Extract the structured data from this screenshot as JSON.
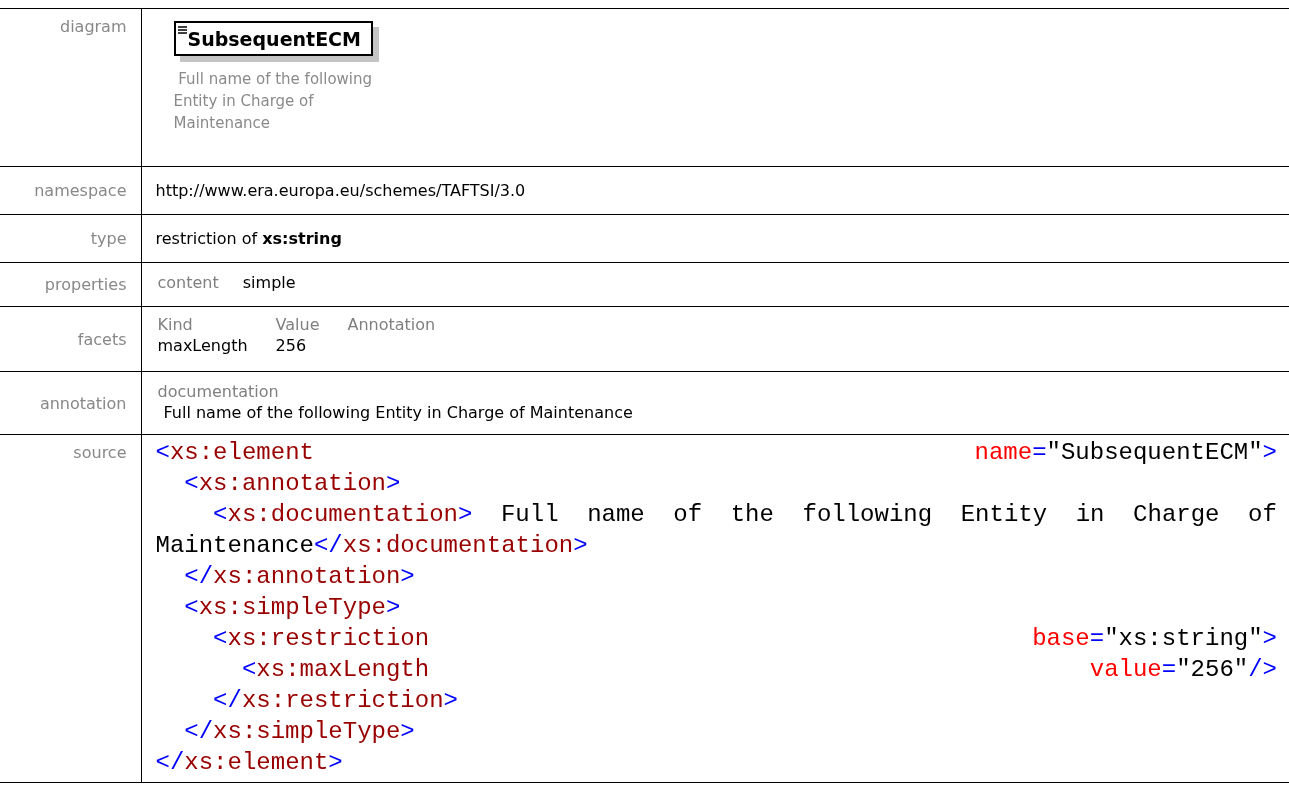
{
  "rows": [
    {
      "label": "diagram",
      "kind": "diagram",
      "element": "SubsequentECM",
      "caption": " Full name of the following Entity in Charge of Maintenance"
    },
    {
      "label": "namespace",
      "kind": "text",
      "text": "http://www.era.europa.eu/schemes/TAFTSI/3.0"
    },
    {
      "label": "type",
      "kind": "rich",
      "text": "restriction of **xs:string**"
    },
    {
      "label": "properties",
      "kind": "pairs",
      "pairs": [
        {
          "key": "content",
          "value": "simple"
        }
      ]
    },
    {
      "label": "facets",
      "kind": "facets",
      "columns": [
        "Kind",
        "Value",
        "Annotation"
      ],
      "rows": [
        [
          "maxLength",
          "256"
        ]
      ]
    },
    {
      "label": "annotation",
      "kind": "annotation",
      "heading": "documentation",
      "text": "Full name of the following Entity in Charge of Maintenance"
    },
    {
      "label": "source",
      "kind": "source",
      "lines": [
        {
          "words": [
            [
              {
                "kind": "bracket",
                "s": "<"
              },
              {
                "kind": "name",
                "s": "xs:element"
              }
            ],
            [
              {
                "kind": "attr",
                "s": "name"
              },
              {
                "kind": "bracket",
                "s": "="
              },
              {
                "kind": "value",
                "s": "\"SubsequentECM\""
              },
              {
                "kind": "bracket",
                "s": ">"
              }
            ]
          ]
        },
        {
          "words": [
            [
              {
                "kind": "bracket",
                "s": "  <"
              },
              {
                "kind": "name",
                "s": "xs:annotation"
              },
              {
                "kind": "bracket",
                "s": ">"
              }
            ]
          ]
        },
        {
          "words": [
            [
              {
                "kind": "bracket",
                "s": "    <"
              },
              {
                "kind": "name",
                "s": "xs:documentation"
              },
              {
                "kind": "bracket",
                "s": ">"
              }
            ],
            [
              {
                "kind": "text",
                "s": "Full"
              }
            ],
            [
              {
                "kind": "text",
                "s": "name"
              }
            ],
            [
              {
                "kind": "text",
                "s": "of"
              }
            ],
            [
              {
                "kind": "text",
                "s": "the"
              }
            ],
            [
              {
                "kind": "text",
                "s": "following"
              }
            ],
            [
              {
                "kind": "text",
                "s": "Entity"
              }
            ],
            [
              {
                "kind": "text",
                "s": "in"
              }
            ],
            [
              {
                "kind": "text",
                "s": "Charge"
              }
            ],
            [
              {
                "kind": "text",
                "s": "of"
              }
            ]
          ]
        },
        {
          "words": [
            [
              {
                "kind": "text",
                "s": "Maintenance"
              },
              {
                "kind": "bracket",
                "s": "</"
              },
              {
                "kind": "name",
                "s": "xs:documentation"
              },
              {
                "kind": "bracket",
                "s": ">"
              }
            ]
          ]
        },
        {
          "words": [
            [
              {
                "kind": "bracket",
                "s": "  </"
              },
              {
                "kind": "name",
                "s": "xs:annotation"
              },
              {
                "kind": "bracket",
                "s": ">"
              }
            ]
          ]
        },
        {
          "words": [
            [
              {
                "kind": "bracket",
                "s": "  <"
              },
              {
                "kind": "name",
                "s": "xs:simpleType"
              },
              {
                "kind": "bracket",
                "s": ">"
              }
            ]
          ]
        },
        {
          "words": [
            [
              {
                "kind": "bracket",
                "s": "    <"
              },
              {
                "kind": "name",
                "s": "xs:restriction"
              }
            ],
            [
              {
                "kind": "attr",
                "s": "base"
              },
              {
                "kind": "bracket",
                "s": "="
              },
              {
                "kind": "value",
                "s": "\"xs:string\""
              },
              {
                "kind": "bracket",
                "s": ">"
              }
            ]
          ]
        },
        {
          "words": [
            [
              {
                "kind": "bracket",
                "s": "      <"
              },
              {
                "kind": "name",
                "s": "xs:maxLength"
              }
            ],
            [
              {
                "kind": "attr",
                "s": "value"
              },
              {
                "kind": "bracket",
                "s": "="
              },
              {
                "kind": "value",
                "s": "\"256\""
              },
              {
                "kind": "bracket",
                "s": "/>"
              }
            ]
          ]
        },
        {
          "words": [
            [
              {
                "kind": "bracket",
                "s": "    </"
              },
              {
                "kind": "name",
                "s": "xs:restriction"
              },
              {
                "kind": "bracket",
                "s": ">"
              }
            ]
          ]
        },
        {
          "words": [
            [
              {
                "kind": "bracket",
                "s": "  </"
              },
              {
                "kind": "name",
                "s": "xs:simpleType"
              },
              {
                "kind": "bracket",
                "s": ">"
              }
            ]
          ]
        },
        {
          "words": [
            [
              {
                "kind": "bracket",
                "s": "</"
              },
              {
                "kind": "name",
                "s": "xs:element"
              },
              {
                "kind": "bracket",
                "s": ">"
              }
            ]
          ]
        }
      ]
    }
  ]
}
